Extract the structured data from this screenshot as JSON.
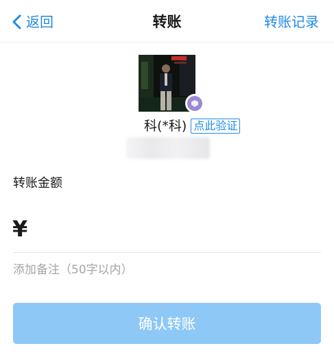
{
  "colors": {
    "accent": "#1e8ae8",
    "button_bg": "#8dc8f6",
    "button_text": "#ffffff",
    "divider": "#e6e6e6",
    "badge": "#9a8ad0"
  },
  "nav": {
    "back_label": "返回",
    "title": "转账",
    "history_label": "转账记录"
  },
  "recipient": {
    "name": "科(*科)",
    "verify_label": "点此验证"
  },
  "form": {
    "amount_label": "转账金额",
    "currency_symbol": "¥",
    "amount_value": "",
    "note_placeholder": "添加备注（50字以内）",
    "note_value": ""
  },
  "actions": {
    "confirm_label": "确认转账"
  }
}
